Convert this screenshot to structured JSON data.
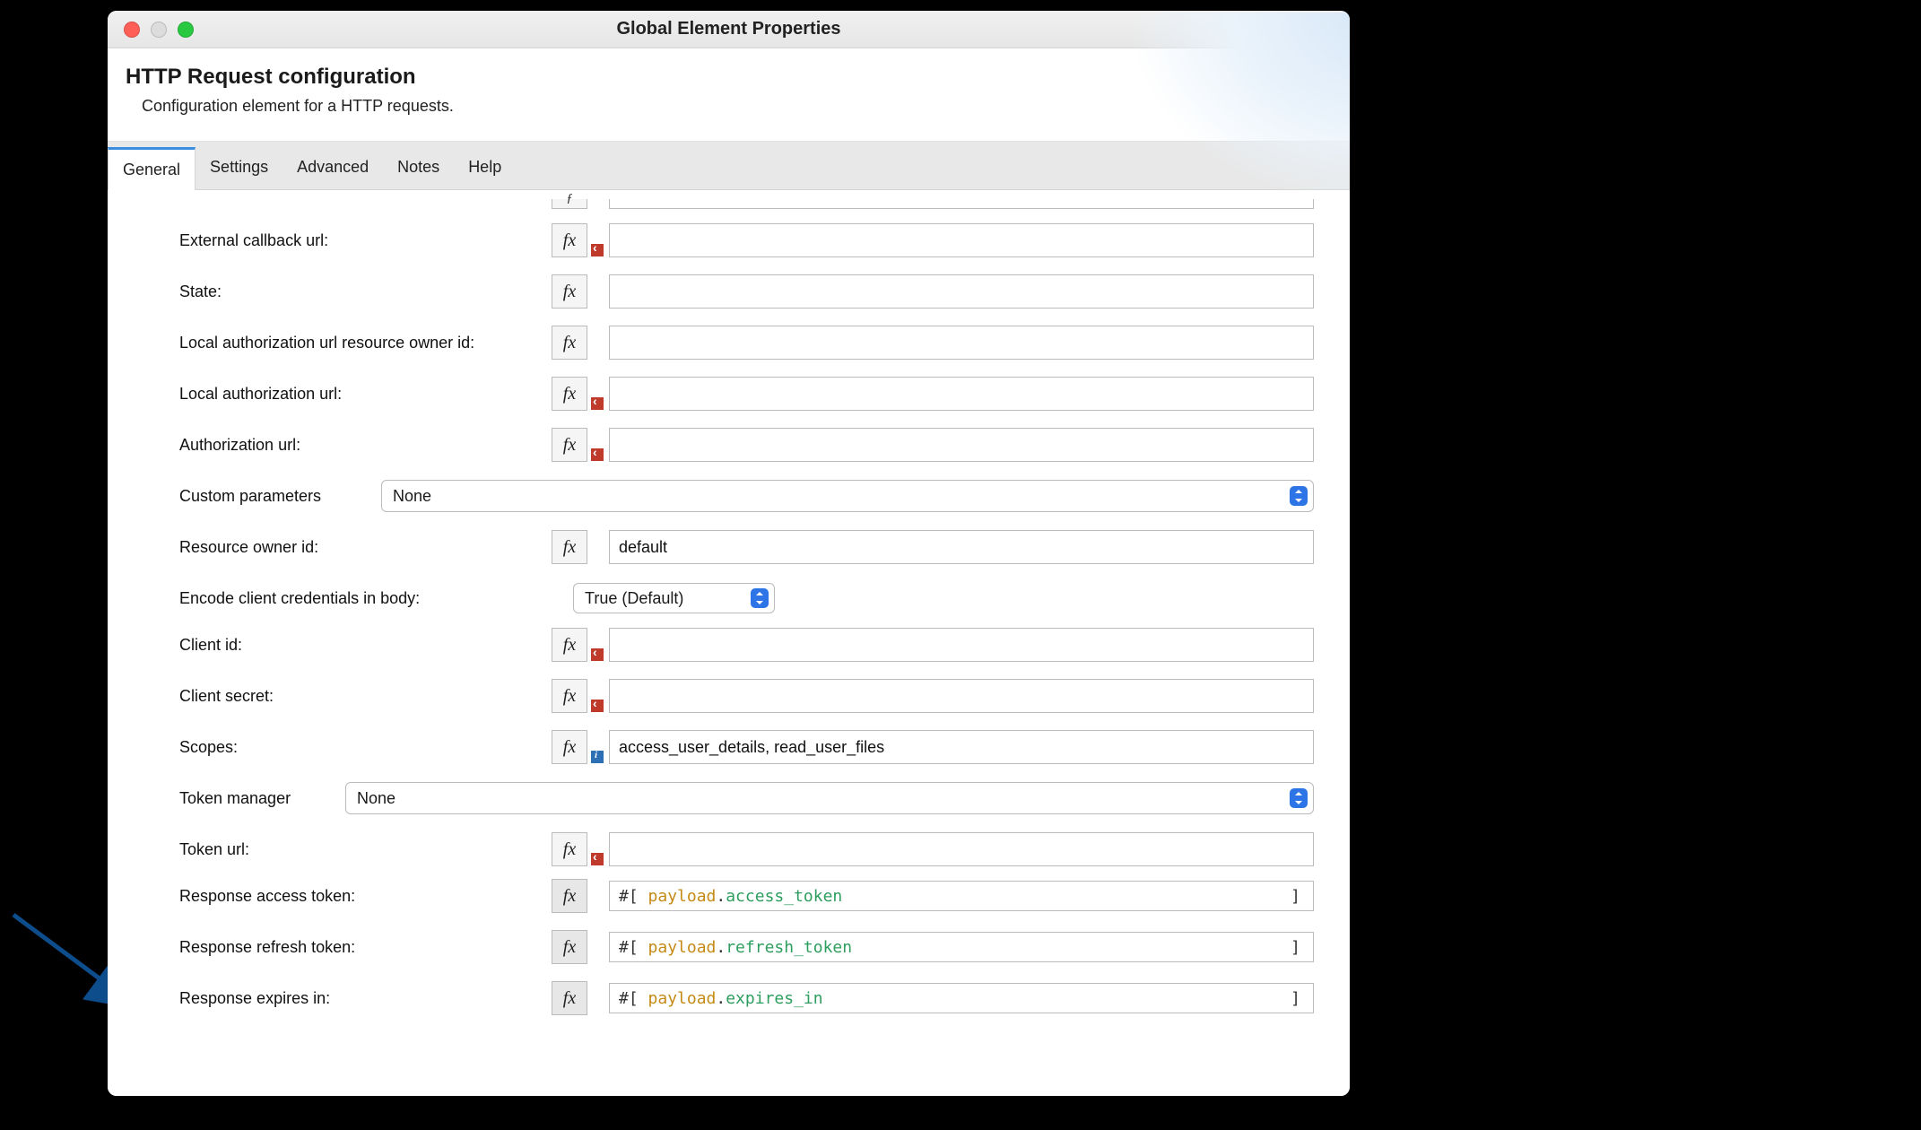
{
  "window": {
    "title": "Global Element Properties"
  },
  "header": {
    "title": "HTTP Request configuration",
    "description": "Configuration element for a HTTP requests."
  },
  "tabs": {
    "general": "General",
    "settings": "Settings",
    "advanced": "Advanced",
    "notes": "Notes",
    "help": "Help"
  },
  "fields": {
    "external_callback_url": {
      "label": "External callback url:",
      "value": ""
    },
    "state": {
      "label": "State:",
      "value": ""
    },
    "local_auth_url_owner_id": {
      "label": "Local authorization url resource owner id:",
      "value": ""
    },
    "local_auth_url": {
      "label": "Local authorization url:",
      "value": ""
    },
    "authorization_url": {
      "label": "Authorization url:",
      "value": ""
    },
    "custom_parameters": {
      "label": "Custom parameters",
      "selected": "None"
    },
    "resource_owner_id": {
      "label": "Resource owner id:",
      "value": "default"
    },
    "encode_client_credentials": {
      "label": "Encode client credentials in body:",
      "selected": "True (Default)"
    },
    "client_id": {
      "label": "Client id:",
      "value": ""
    },
    "client_secret": {
      "label": "Client secret:",
      "value": ""
    },
    "scopes": {
      "label": "Scopes:",
      "value": "access_user_details, read_user_files"
    },
    "token_manager": {
      "label": "Token manager",
      "selected": "None"
    },
    "token_url": {
      "label": "Token url:",
      "value": ""
    },
    "response_access_token": {
      "label": "Response access token:",
      "prefix": "#[ ",
      "obj": "payload",
      "dot": ".",
      "prop": "access_token",
      "suffix": "]"
    },
    "response_refresh_token": {
      "label": "Response refresh token:",
      "prefix": "#[ ",
      "obj": "payload",
      "dot": ".",
      "prop": "refresh_token",
      "suffix": "]"
    },
    "response_expires_in": {
      "label": "Response expires in:",
      "prefix": "#[ ",
      "obj": "payload",
      "dot": ".",
      "prop": "expires_in",
      "suffix": "]"
    }
  },
  "fx": "fx"
}
